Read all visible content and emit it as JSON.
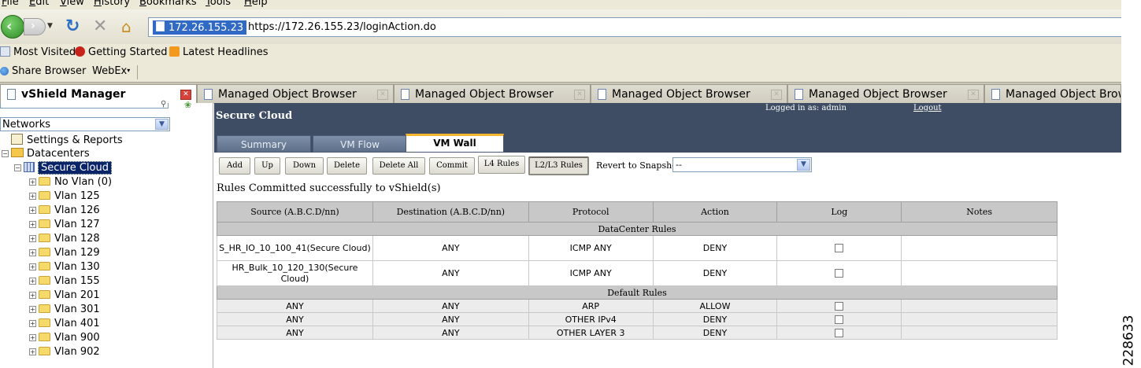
{
  "menu": [
    "File",
    "Edit",
    "View",
    "History",
    "Bookmarks",
    "Tools",
    "Help"
  ],
  "nav": {
    "url_host": "172.26.155.23",
    "url_text": "https://172.26.155.23/loginAction.do"
  },
  "bookmarks": {
    "row1": [
      "Most Visited",
      "Getting Started",
      "Latest Headlines"
    ],
    "row2": [
      "Share Browser",
      "WebEx"
    ]
  },
  "tabs": [
    {
      "label": "vShield Manager"
    },
    {
      "label": "Managed Object Browser"
    },
    {
      "label": "Managed Object Browser"
    },
    {
      "label": "Managed Object Browser"
    },
    {
      "label": "Managed Object Browser"
    },
    {
      "label": "Managed Object Browse"
    }
  ],
  "sidebar": {
    "view_select": "Networks",
    "settings": "Settings & Reports",
    "datacenters": "Datacenters",
    "secure_cloud": "Secure Cloud",
    "vlans": [
      "No Vlan (0)",
      "Vlan 125",
      "Vlan 126",
      "Vlan 127",
      "Vlan 128",
      "Vlan 129",
      "Vlan 130",
      "Vlan 155",
      "Vlan 201",
      "Vlan 301",
      "Vlan 401",
      "Vlan 900",
      "Vlan 902"
    ]
  },
  "header": {
    "title": "Secure Cloud",
    "logged_in": "Logged in as: admin",
    "logout": "Logout",
    "tabs": [
      "Summary",
      "VM Flow",
      "VM Wall"
    ]
  },
  "toolbar": {
    "add": "Add",
    "up": "Up",
    "down": "Down",
    "delete": "Delete",
    "delete_all": "Delete All",
    "commit": "Commit",
    "l4": "L4 Rules",
    "l2l3": "L2/L3 Rules",
    "revert_label": "Revert to Snapshot",
    "snapshot_value": "--"
  },
  "status_message": "Rules Committed successfully to vShield(s)",
  "table": {
    "columns": [
      "Source (A.B.C.D/nn)",
      "Destination (A.B.C.D/nn)",
      "Protocol",
      "Action",
      "Log",
      "Notes"
    ],
    "datacenter_section": "DataCenter Rules",
    "datacenter_rows": [
      {
        "source": "S_HR_IO_10_100_41(Secure Cloud)",
        "destination": "ANY",
        "protocol": "ICMP ANY",
        "action": "DENY",
        "log": false,
        "notes": ""
      },
      {
        "source": "HR_Bulk_10_120_130(Secure Cloud)",
        "destination": "ANY",
        "protocol": "ICMP ANY",
        "action": "DENY",
        "log": false,
        "notes": ""
      }
    ],
    "default_section": "Default Rules",
    "default_rows": [
      {
        "source": "ANY",
        "destination": "ANY",
        "protocol": "ARP",
        "action": "ALLOW",
        "log": false,
        "notes": ""
      },
      {
        "source": "ANY",
        "destination": "ANY",
        "protocol": "OTHER IPv4",
        "action": "DENY",
        "log": false,
        "notes": ""
      },
      {
        "source": "ANY",
        "destination": "ANY",
        "protocol": "OTHER LAYER 3",
        "action": "DENY",
        "log": false,
        "notes": ""
      }
    ]
  },
  "figure_number": "228633"
}
